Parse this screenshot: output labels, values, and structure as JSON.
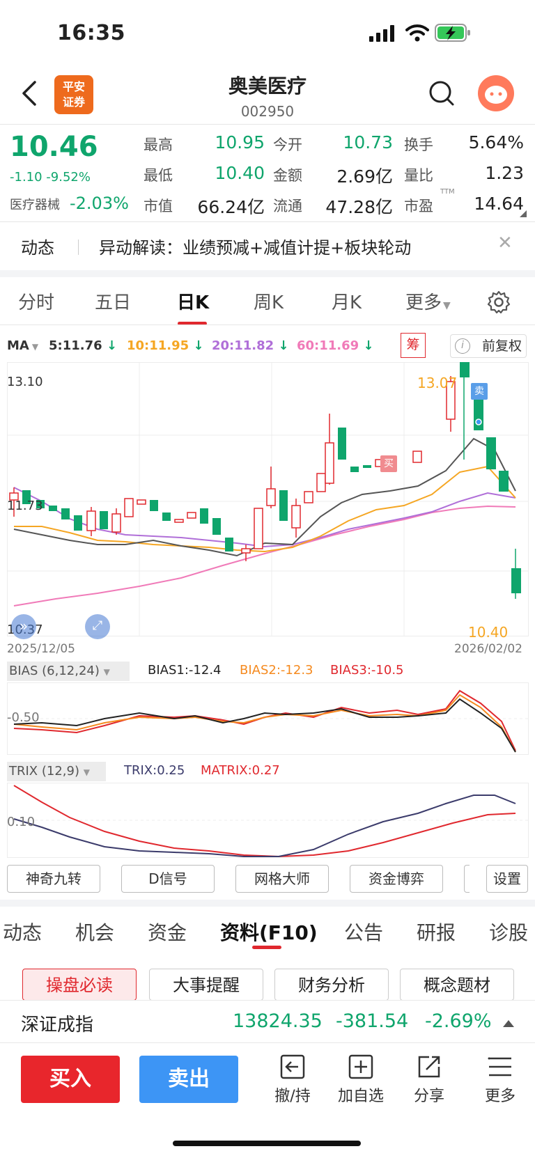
{
  "status_bar": {
    "time": "16:35"
  },
  "header": {
    "logo_text_1": "平安",
    "logo_text_2": "证券",
    "name": "奥美医疗",
    "code": "002950"
  },
  "quote": {
    "price": "10.46",
    "change": "-1.10 -9.52%",
    "sector": "医疗器械",
    "sector_change": "-2.03%",
    "fields": [
      {
        "label": "最高",
        "value": "10.95"
      },
      {
        "label": "今开",
        "value": "10.73"
      },
      {
        "label": "换手",
        "value": "5.64%"
      },
      {
        "label": "最低",
        "value": "10.40"
      },
      {
        "label": "金额",
        "value": "2.69亿"
      },
      {
        "label": "量比",
        "value": "1.23"
      },
      {
        "label": "市值",
        "value": "66.24亿"
      },
      {
        "label": "流通",
        "value": "47.28亿"
      },
      {
        "label": "市盈",
        "value": "14.64"
      }
    ],
    "pe_superscript": "TTM"
  },
  "news": {
    "tag": "动态",
    "text": "异动解读：业绩预减+减值计提+板块轮动"
  },
  "period_tabs": [
    "分时",
    "五日",
    "日K",
    "周K",
    "月K",
    "更多"
  ],
  "period_active": "日K",
  "ma": {
    "label": "MA",
    "items": [
      {
        "text": "5:11.76",
        "color": "#333333"
      },
      {
        "text": "10:11.95",
        "color": "#f5a623"
      },
      {
        "text": "20:11.82",
        "color": "#b06fd8"
      },
      {
        "text": "60:11.69",
        "color": "#f07ab8"
      }
    ],
    "chou": "筹",
    "fuquan": "前复权"
  },
  "kline": {
    "price_top": "13.10",
    "price_mid": "11.73",
    "price_bottom": "10.37",
    "high_label": "13.07",
    "low_label": "10.40",
    "date_start": "2025/12/05",
    "date_end": "2026/02/02",
    "buy_marker": "买",
    "sell_marker": "卖"
  },
  "bias": {
    "selector": "BIAS (6,12,24)",
    "b1": "BIAS1:-12.4",
    "b2": "BIAS2:-12.3",
    "b3": "BIAS3:-10.5",
    "axis": "-0.50"
  },
  "trix": {
    "selector": "TRIX (12,9)",
    "t": "TRIX:0.25",
    "m": "MATRIX:0.27",
    "axis": "0.10"
  },
  "tools": [
    "神奇九转",
    "D信号",
    "网格大师",
    "资金博弈"
  ],
  "tools_settings": "设置",
  "bottom_tabs": [
    "动态",
    "机会",
    "资金",
    "资料(F10)",
    "公告",
    "研报",
    "诊股"
  ],
  "bottom_active": "资料(F10)",
  "sub_tabs": [
    "操盘必读",
    "大事提醒",
    "财务分析",
    "概念题材"
  ],
  "index_bar": {
    "name": "深证成指",
    "value": "13824.35",
    "change": "-381.54",
    "pct": "-2.69%"
  },
  "actions": {
    "buy": "买入",
    "sell": "卖出",
    "items": [
      {
        "label": "撤/持",
        "icon": "withdraw-icon"
      },
      {
        "label": "加自选",
        "icon": "add-watchlist-icon"
      },
      {
        "label": "分享",
        "icon": "share-icon"
      },
      {
        "label": "更多",
        "icon": "more-menu-icon"
      }
    ]
  },
  "colors": {
    "up": "#e0282e",
    "down": "#0fa56c",
    "accent": "#3d95f5"
  }
}
